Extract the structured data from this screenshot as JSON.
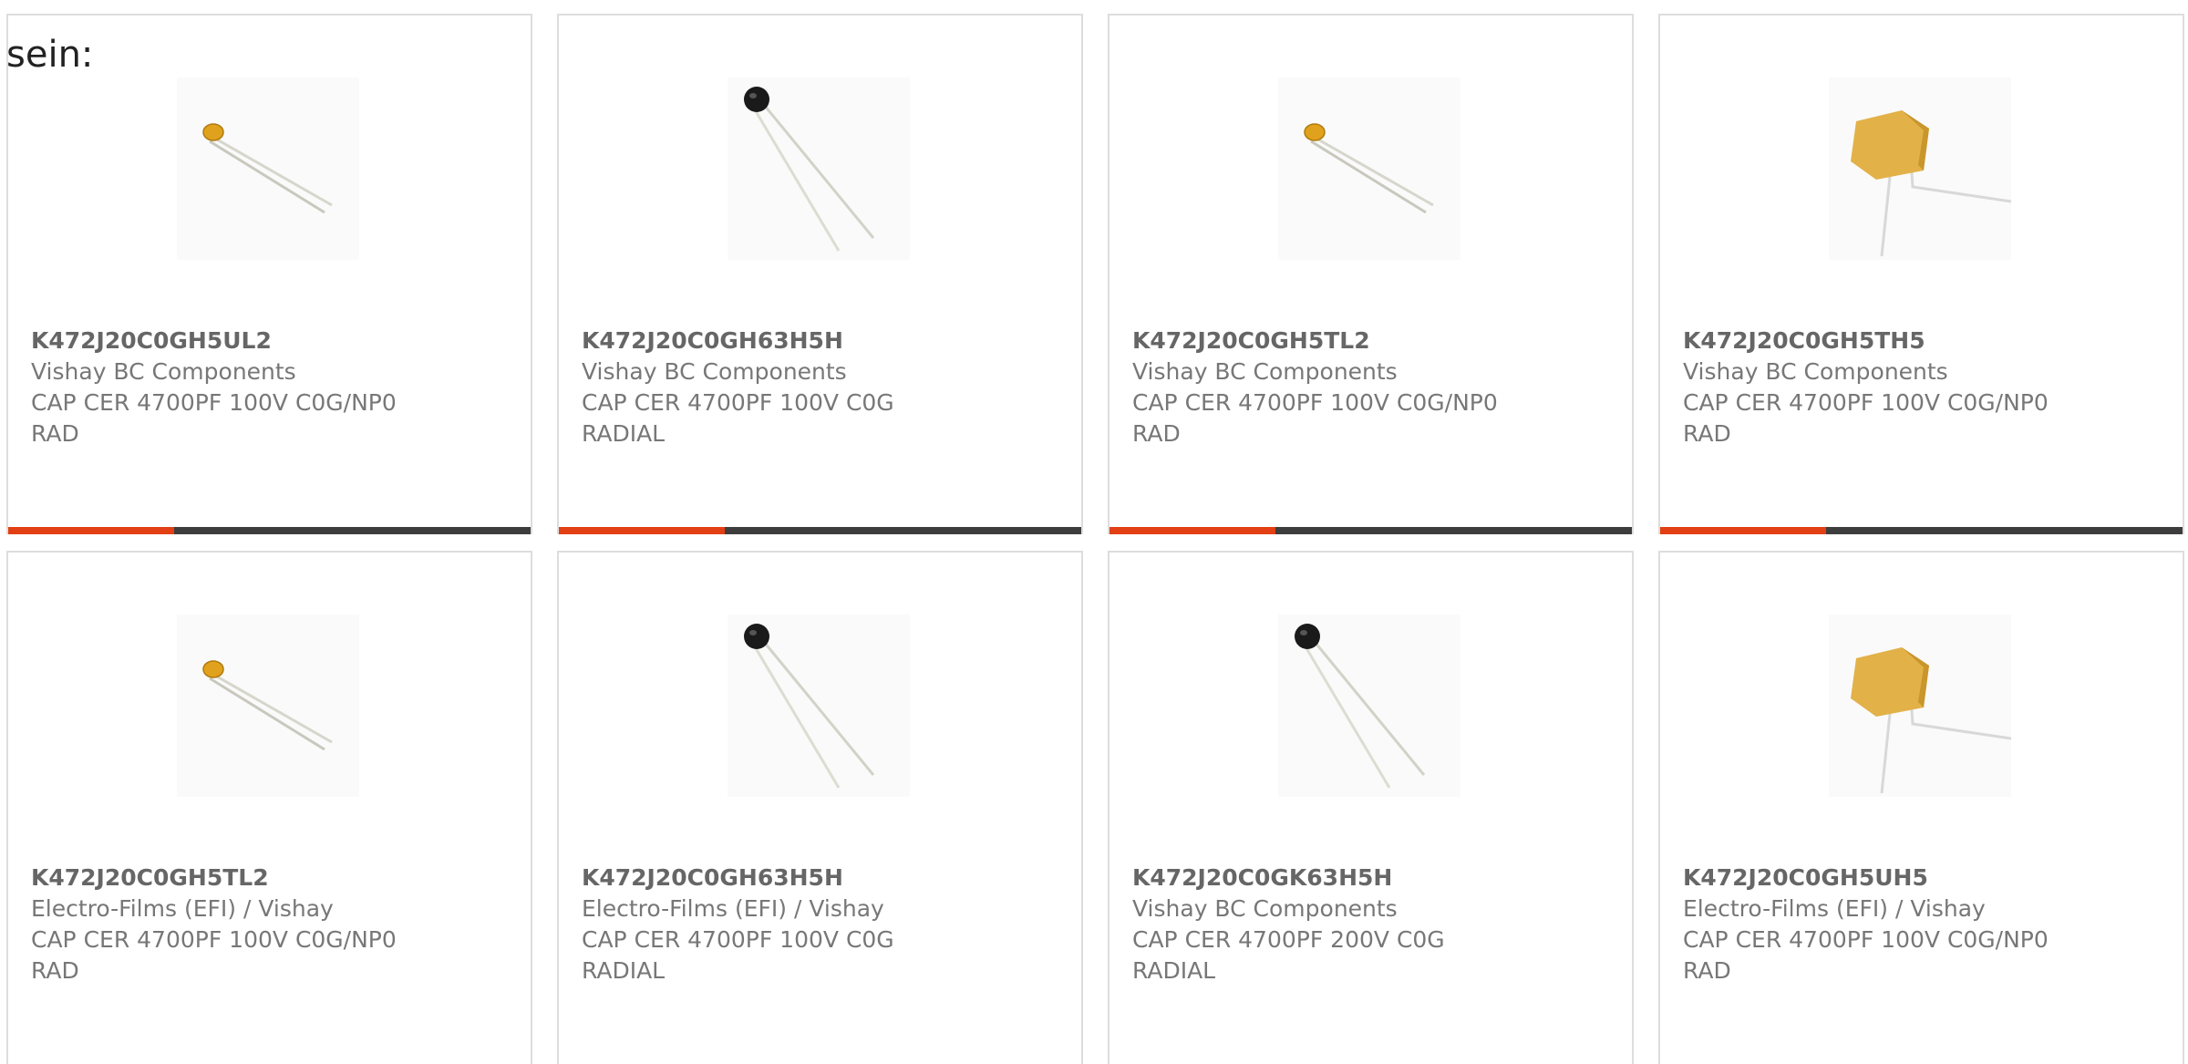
{
  "intro_text": "sein:",
  "colors": {
    "accent": "#e33f14",
    "bar": "#3d3d3d",
    "border": "#dddddd",
    "text": "#777777"
  },
  "products": [
    {
      "part_number": "K472J20C0GH5UL2",
      "manufacturer": "Vishay BC Components",
      "description": "CAP CER 4700PF 100V C0G/NP0 RAD",
      "image_icon": "ceramic-disc-capacitor-icon"
    },
    {
      "part_number": "K472J20C0GH63H5H",
      "manufacturer": "Vishay BC Components",
      "description": "CAP CER 4700PF 100V C0G RADIAL",
      "image_icon": "black-bead-capacitor-icon"
    },
    {
      "part_number": "K472J20C0GH5TL2",
      "manufacturer": "Vishay BC Components",
      "description": "CAP CER 4700PF 100V C0G/NP0 RAD",
      "image_icon": "ceramic-disc-capacitor-icon"
    },
    {
      "part_number": "K472J20C0GH5TH5",
      "manufacturer": "Vishay BC Components",
      "description": "CAP CER 4700PF 100V C0G/NP0 RAD",
      "image_icon": "box-capacitor-icon"
    },
    {
      "part_number": "K472J20C0GH5TL2",
      "manufacturer": "Electro-Films (EFI) / Vishay",
      "description": "CAP CER 4700PF 100V C0G/NP0 RAD",
      "image_icon": "ceramic-disc-capacitor-icon"
    },
    {
      "part_number": "K472J20C0GH63H5H",
      "manufacturer": "Electro-Films (EFI) / Vishay",
      "description": "CAP CER 4700PF 100V C0G RADIAL",
      "image_icon": "black-bead-capacitor-icon"
    },
    {
      "part_number": "K472J20C0GK63H5H",
      "manufacturer": "Vishay BC Components",
      "description": "CAP CER 4700PF 200V C0G RADIAL",
      "image_icon": "black-bead-capacitor-icon"
    },
    {
      "part_number": "K472J20C0GH5UH5",
      "manufacturer": "Electro-Films (EFI) / Vishay",
      "description": "CAP CER 4700PF 100V C0G/NP0 RAD",
      "image_icon": "box-capacitor-icon"
    }
  ]
}
